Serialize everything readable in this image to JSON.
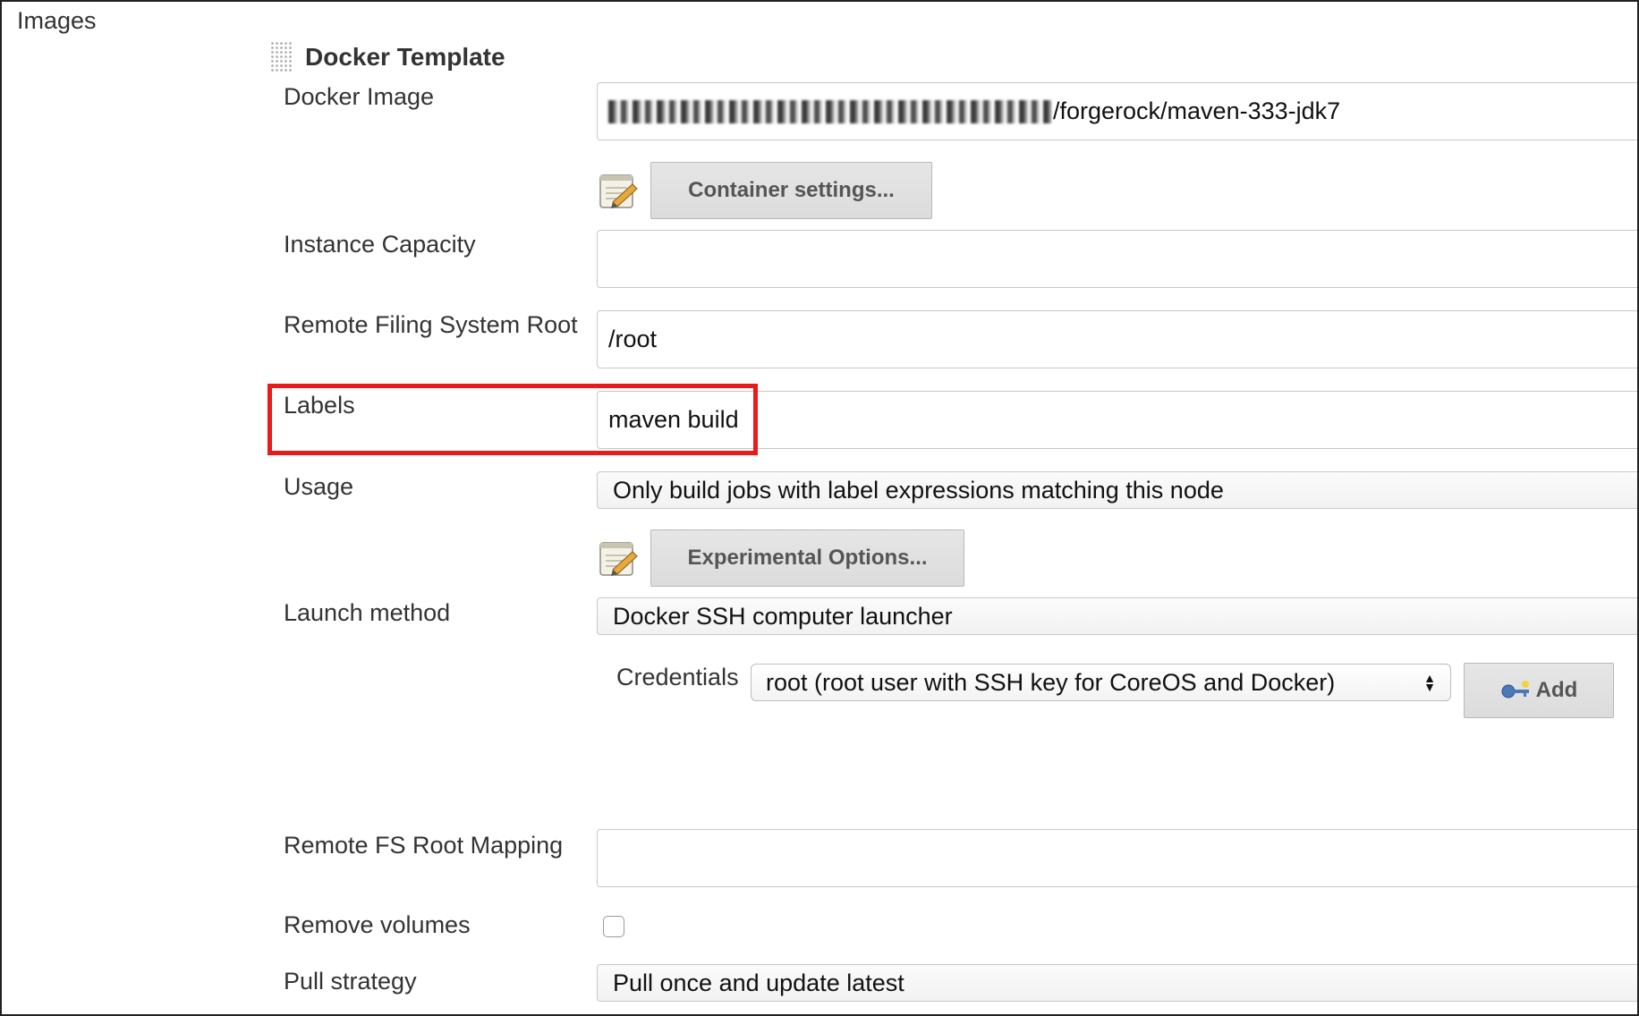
{
  "section": {
    "title": "Images"
  },
  "template": {
    "title": "Docker Template"
  },
  "fields": {
    "docker_image": {
      "label": "Docker Image",
      "value_visible": "/forgerock/maven-333-jdk7"
    },
    "container_settings": {
      "button": "Container settings..."
    },
    "instance_capacity": {
      "label": "Instance Capacity",
      "value": ""
    },
    "remote_fs_root": {
      "label": "Remote Filing System Root",
      "value": "/root"
    },
    "labels": {
      "label": "Labels",
      "value": "maven build"
    },
    "usage": {
      "label": "Usage",
      "value": "Only build jobs with label expressions matching this node"
    },
    "experimental": {
      "button": "Experimental Options..."
    },
    "launch_method": {
      "label": "Launch method",
      "value": "Docker SSH computer launcher"
    },
    "credentials": {
      "label": "Credentials",
      "value": "root (root user with SSH key for CoreOS and Docker)",
      "add_button": "Add"
    },
    "remote_fs_mapping": {
      "label": "Remote FS Root Mapping",
      "value": ""
    },
    "remove_volumes": {
      "label": "Remove volumes",
      "checked": false
    },
    "pull_strategy": {
      "label": "Pull strategy",
      "value": "Pull once and update latest"
    }
  },
  "icons": {
    "drag_handle": "drag-handle-icon",
    "notepad": "notepad-pencil-icon",
    "key": "key-icon",
    "select_arrows": "select-arrows-icon"
  },
  "colors": {
    "highlight": "#e81a1a"
  }
}
